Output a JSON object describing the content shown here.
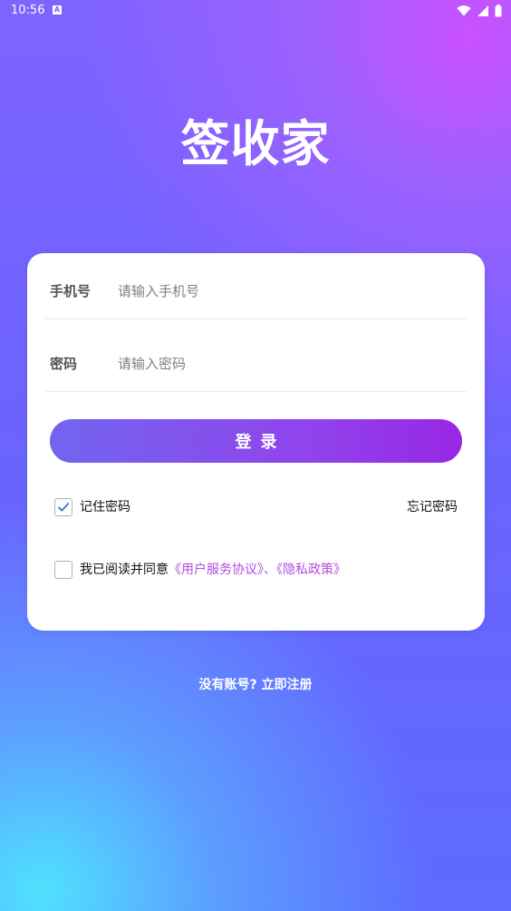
{
  "status_bar": {
    "time": "10:56",
    "notification_icon": "a-icon",
    "wifi_icon": "wifi-icon",
    "signal_icon": "signal-icon",
    "battery_icon": "battery-icon"
  },
  "app": {
    "title": "签收家"
  },
  "login_form": {
    "phone_label": "手机号",
    "phone_placeholder": "请输入手机号",
    "phone_value": "",
    "password_label": "密码",
    "password_placeholder": "请输入密码",
    "password_value": "",
    "login_button": "登录",
    "remember_label": "记住密码",
    "remember_checked": true,
    "forgot_password": "忘记密码",
    "agreement_checked": false,
    "agreement_prefix": "我已阅读并同意",
    "service_agreement": "《用户服务协议》",
    "agreement_separator": "、",
    "privacy_policy": "《隐私政策》"
  },
  "register": {
    "text": "没有账号? 立即注册"
  },
  "colors": {
    "background_top": "#7f63ff",
    "background_pink": "#ce50ff",
    "background_cyan": "#4ee8ff",
    "button_start": "#7265ef",
    "button_end": "#9827e4",
    "link": "#b14be1",
    "checkbox_check": "#2d7ad8"
  }
}
